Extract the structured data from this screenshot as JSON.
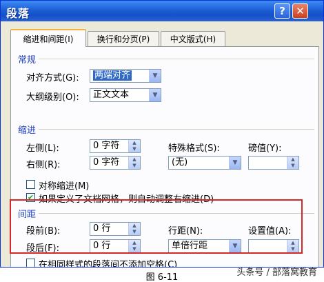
{
  "window": {
    "title": "段落"
  },
  "titlebar": {
    "help_label": "?",
    "close_label": "✕"
  },
  "tabs": [
    {
      "label": "缩进和间距(I)",
      "active": true
    },
    {
      "label": "换行和分页(P)",
      "active": false
    },
    {
      "label": "中文版式(H)",
      "active": false
    }
  ],
  "general": {
    "title": "常规",
    "alignment_label": "对齐方式(G):",
    "alignment_value": "两端对齐",
    "outline_label": "大纲级别(O):",
    "outline_value": "正文文本"
  },
  "indent": {
    "title": "缩进",
    "left_label": "左侧(L):",
    "left_value": "0 字符",
    "right_label": "右侧(R):",
    "right_value": "0 字符",
    "special_label": "特殊格式(S):",
    "special_value": "(无)",
    "by_label": "磅值(Y):",
    "by_value": "",
    "mirror_label": "对称缩进(M)",
    "mirror_checked": false,
    "grid_label": "如果定义了文档网格，则自动调整右缩进(D)",
    "grid_checked": true
  },
  "spacing": {
    "title": "间距",
    "before_label": "段前(B):",
    "before_value": "0 行",
    "after_label": "段后(F):",
    "after_value": "0 行",
    "line_label": "行距(N):",
    "line_value": "单倍行距",
    "at_label": "设置值(A):",
    "at_value": "",
    "no_space_label": "在相同样式的段落间不添加空格(C)",
    "no_space_checked": false
  },
  "watermark": "头条号 / 部落窝教育",
  "caption": "图 6-11"
}
